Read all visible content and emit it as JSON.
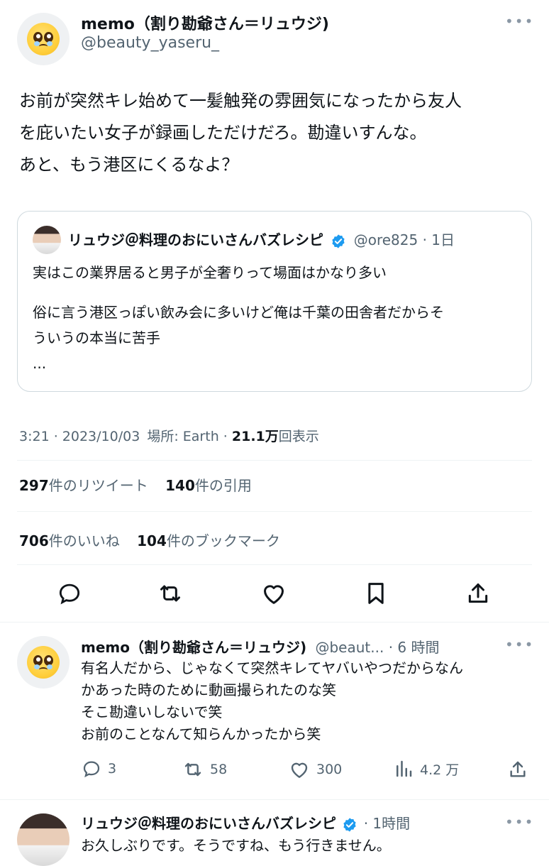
{
  "main_tweet": {
    "author_name": "memo（割り勘爺さん＝リュウジ)",
    "author_handle": "@beauty_yaseru_",
    "more": "•••",
    "body_lines": [
      "お前が突然キレ始めて一髪触発の雰囲気になったから友人",
      "を庇いたい女子が録画しただけだろ。勘違いすんな。",
      "あと、もう港区にくるなよ？"
    ]
  },
  "quoted_tweet": {
    "author_name": "リュウジ＠料理のおにいさんバズレシピ",
    "author_handle": "@ore825",
    "time": "· 1日",
    "lines": [
      "実はこの業界居ると男子が全奢りって場面はかなり多い",
      "",
      "俗に言う港区っぽい飲み会に多いけど俺は千葉の田舎者だからそ",
      "ういうの本当に苦手",
      "..."
    ]
  },
  "meta": {
    "time": "3:21 · 2023/10/03",
    "location_label": "場所: Earth",
    "sep": "·",
    "views_count": "21.1万",
    "views_label": "回表示"
  },
  "stats": {
    "retweets_count": "297",
    "retweets_label": "件のリツイート",
    "quotes_count": "140",
    "quotes_label": "件の引用",
    "likes_count": "706",
    "likes_label": "件のいいね",
    "bookmarks_count": "104",
    "bookmarks_label": "件のブックマーク"
  },
  "actions": [
    "reply-icon",
    "retweet-icon",
    "like-icon",
    "bookmark-icon",
    "share-icon"
  ],
  "reply1": {
    "author_name": "memo（割り勘爺さん＝リュウジ)",
    "author_handle": "@beaut...",
    "time": "· 6 時間",
    "more": "•••",
    "lines": [
      "有名人だから、じゃなくて突然キレてヤバいやつだからなん",
      "かあった時のために動画撮られたのな笑",
      "そこ勘違いしないで笑",
      "お前のことなんて知らんかったから笑"
    ],
    "replies": "3",
    "retweets": "58",
    "likes": "300",
    "views": "4.2 万"
  },
  "reply2": {
    "author_name": "リュウジ＠料理のおにいさんバズレシピ",
    "time": "· 1時間",
    "more": "•••",
    "line": "お久しぶりです。そうですね、もう行きません。"
  },
  "colors": {
    "verified": "#1d9bf0",
    "text": "#0f1419",
    "muted": "#536471",
    "border": "#cfd9de"
  }
}
